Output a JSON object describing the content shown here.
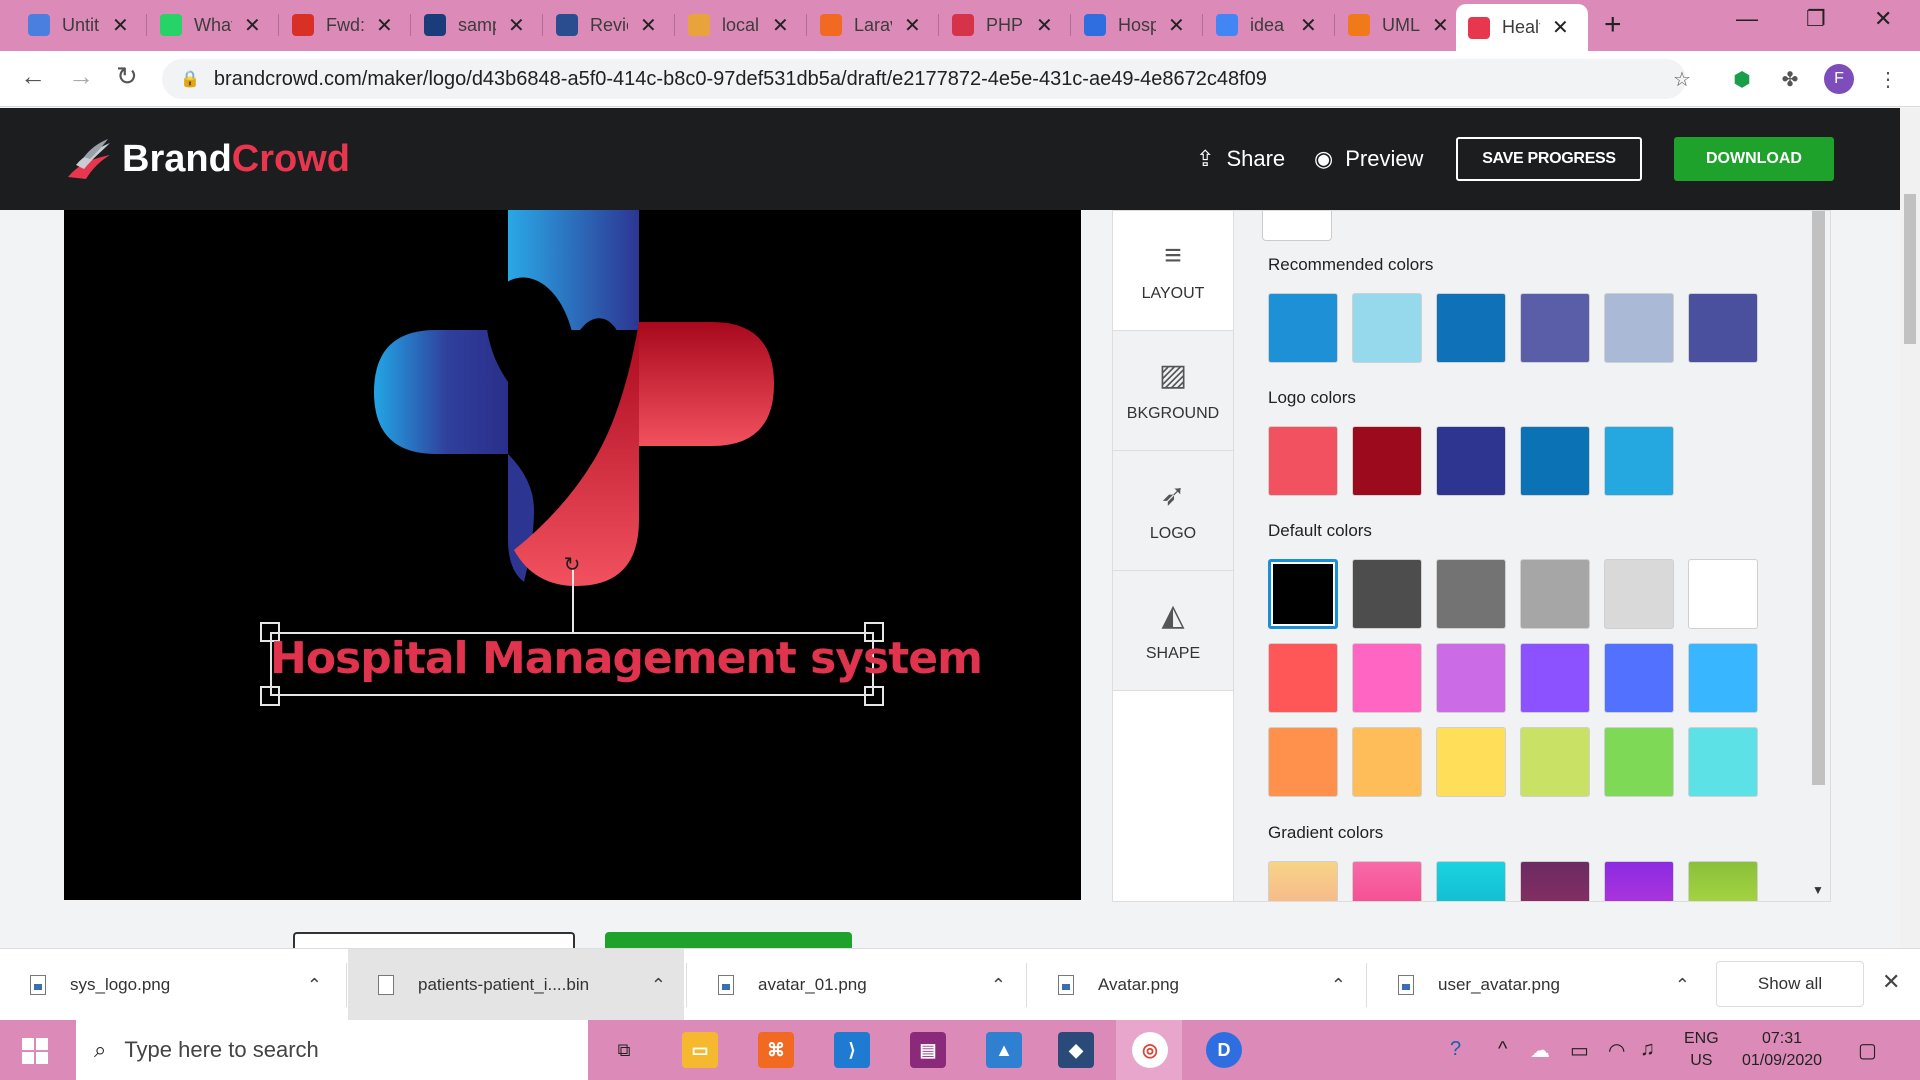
{
  "browser": {
    "tabs": [
      {
        "title": "Untitled",
        "icon": "google-docs-icon",
        "color": "#4a7fe0"
      },
      {
        "title": "WhatsApp",
        "icon": "whatsapp-icon",
        "color": "#25d366"
      },
      {
        "title": "Fwd:",
        "icon": "gmail-icon",
        "color": "#d93025"
      },
      {
        "title": "sample",
        "icon": "text-icon",
        "color": "#1b3c7a"
      },
      {
        "title": "Review",
        "icon": "bit-icon",
        "color": "#2a4d8f"
      },
      {
        "title": "localhost",
        "icon": "phpmyadmin-icon",
        "color": "#e8a33d"
      },
      {
        "title": "Laravel",
        "icon": "xampp-icon",
        "color": "#f26a22"
      },
      {
        "title": "PHP",
        "icon": "w3-icon",
        "color": "#d6334a"
      },
      {
        "title": "Hospital",
        "icon": "f-icon",
        "color": "#2f6ee0"
      },
      {
        "title": "idea",
        "icon": "google-icon",
        "color": "#4285f4"
      },
      {
        "title": "UML",
        "icon": "uml-icon",
        "color": "#f07a1a"
      },
      {
        "title": "Health",
        "icon": "brandcrowd-icon",
        "color": "#e8364f"
      }
    ],
    "url": "brandcrowd.com/maker/logo/d43b6848-a5f0-414c-b8c0-97def531db5a/draft/e2177872-4e5e-431c-ae49-4e8672c48f09",
    "profile_initial": "F"
  },
  "header": {
    "brand_part1": "Brand",
    "brand_part2": "Crowd",
    "share_label": "Share",
    "preview_label": "Preview",
    "save_label": "SAVE PROGRESS",
    "download_label": "DOWNLOAD"
  },
  "canvas": {
    "logo_text": "Hospital Management system",
    "text_color": "#e0334d"
  },
  "tools": [
    {
      "label": "LAYOUT",
      "icon": "layout-icon"
    },
    {
      "label": "BKGROUND",
      "icon": "background-icon"
    },
    {
      "label": "LOGO",
      "icon": "logo-icon"
    },
    {
      "label": "SHAPE",
      "icon": "shape-icon"
    }
  ],
  "colors": {
    "recommended_title": "Recommended colors",
    "recommended": [
      "#1e90d6",
      "#96d8ec",
      "#0f72b8",
      "#5a5ea8",
      "#a9b9d6",
      "#4a4f9e"
    ],
    "logo_title": "Logo colors",
    "logo": [
      "#f2515f",
      "#9c0a1e",
      "#2e3591",
      "#0b72b5",
      "#25a7e0"
    ],
    "default_title": "Default colors",
    "default": [
      "#000000",
      "#4d4d4d",
      "#737373",
      "#a6a6a6",
      "#d9d9d9",
      "#ffffff",
      "#ff5757",
      "#ff66c4",
      "#cb6ce6",
      "#8c52ff",
      "#5271ff",
      "#38b6ff",
      "#ff914d",
      "#ffbd59",
      "#ffde59",
      "#c9e265",
      "#7ed957",
      "#5ce1e6"
    ],
    "gradient_title": "Gradient colors",
    "gradient": [
      [
        "#f7d488",
        "#f6a98b"
      ],
      [
        "#f86aa8",
        "#f43e86"
      ],
      [
        "#1ad3e0",
        "#0fb1c9"
      ],
      [
        "#6b2b63",
        "#93305f"
      ],
      [
        "#8b2be2",
        "#c03ad8"
      ],
      [
        "#8ac03a",
        "#b5e048"
      ]
    ]
  },
  "downloads": [
    {
      "name": "sys_logo.png"
    },
    {
      "name": "patients-patient_i....bin"
    },
    {
      "name": "avatar_01.png"
    },
    {
      "name": "Avatar.png"
    },
    {
      "name": "user_avatar.png"
    }
  ],
  "downloads_show_all": "Show all",
  "taskbar": {
    "search_placeholder": "Type here to search",
    "lang": "ENG",
    "region": "US",
    "time": "07:31",
    "date": "01/09/2020"
  }
}
